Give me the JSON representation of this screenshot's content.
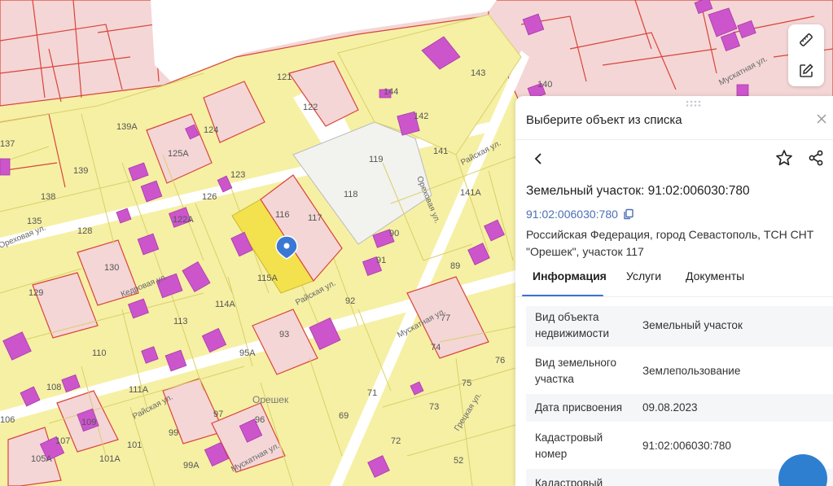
{
  "map": {
    "parcel_labels": [
      "139A",
      "125A",
      "124",
      "123",
      "121",
      "122",
      "126",
      "128",
      "138",
      "139",
      "135",
      "130",
      "129",
      "116",
      "117",
      "115A",
      "114A",
      "113",
      "110",
      "111A",
      "108",
      "109",
      "106",
      "107",
      "105A",
      "101A",
      "101",
      "99",
      "99A",
      "97",
      "96",
      "95A",
      "93",
      "92",
      "91",
      "90",
      "89",
      "119",
      "118",
      "141",
      "141A",
      "142",
      "143",
      "144",
      "140",
      "137",
      "77",
      "76",
      "74",
      "75",
      "73",
      "72",
      "71",
      "69",
      "52",
      "122A"
    ],
    "street_labels": [
      "Кедровая ул.",
      "Райская ул.",
      "Ореховая ул.",
      "Райская ул.",
      "Мускатная ул.",
      "Мускатная ул.",
      "Грецкая ул.",
      "Райская ул.",
      "Мускатная ул.",
      "Ореховая ул."
    ],
    "area_label": "Орешек",
    "colors": {
      "parcel_fill": "#f6f0a4",
      "parcel_stroke": "#d9cf6a",
      "pink_fill": "#f4d6d6",
      "red_border": "#d9443a",
      "building": "#cc55cc",
      "road": "#ffffff",
      "selected": "#f3e24d",
      "white_lot": "#f2f2ef",
      "marker": "#3b78d4"
    }
  },
  "toolbar": {
    "ruler_icon": "ruler-icon",
    "edit_icon": "edit-note-icon"
  },
  "panel": {
    "title": "Выберите объект из списка",
    "object_title": "Земельный участок: 91:02:006030:780",
    "cad_number_link": "91:02:006030:780",
    "address_line1": "Российская Федерация, город Севастополь, ТСН СНТ",
    "address_line2": "\"Орешек\", участок 117",
    "tabs": [
      {
        "label": "Информация",
        "active": true
      },
      {
        "label": "Услуги",
        "active": false
      },
      {
        "label": "Документы",
        "active": false
      }
    ],
    "rows": [
      {
        "key1": "Вид объекта",
        "key2": "недвижимости",
        "value": "Земельный участок"
      },
      {
        "key1": "Вид земельного",
        "key2": "участка",
        "value": "Землепользование"
      },
      {
        "key1": "Дата присвоения",
        "key2": "",
        "value": "09.08.2023"
      },
      {
        "key1": "Кадастровый",
        "key2": "номер",
        "value": "91:02:006030:780"
      },
      {
        "key1": "Кадастровый",
        "key2": "",
        "value": ""
      }
    ]
  }
}
